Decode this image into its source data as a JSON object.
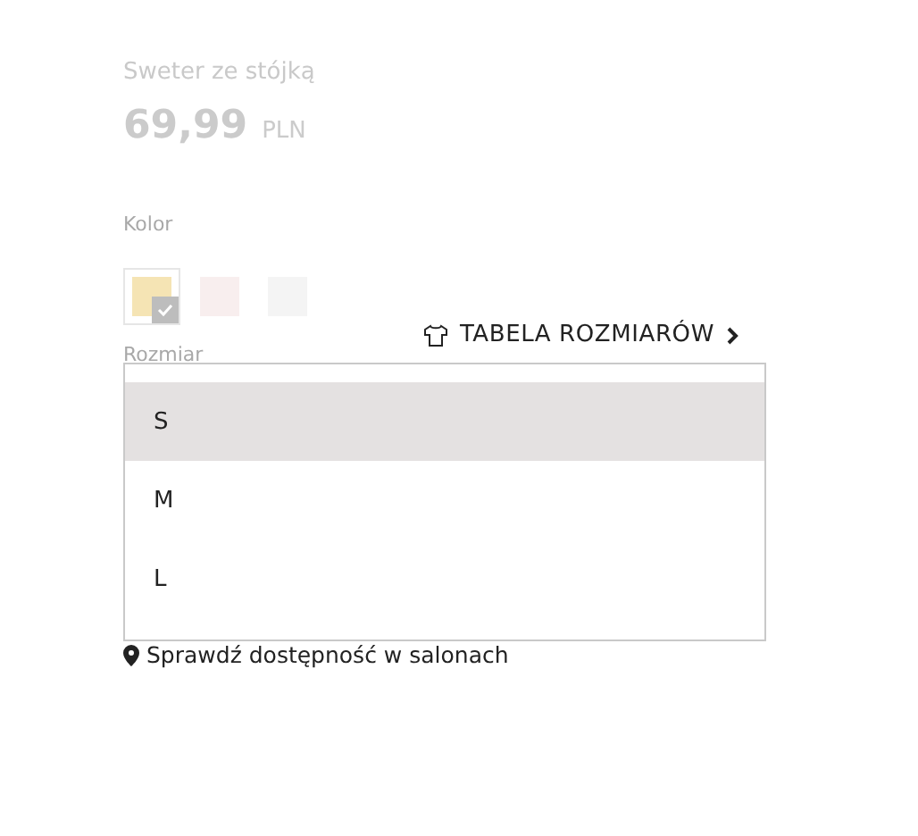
{
  "product": {
    "title": "Sweter ze stójką",
    "price": "69,99",
    "currency": "PLN"
  },
  "color_label": "Kolor",
  "swatches": [
    {
      "color": "#f5e4b4",
      "selected": true
    },
    {
      "color": "#f8eeee",
      "selected": false
    },
    {
      "color": "#f4f4f4",
      "selected": false
    }
  ],
  "size_chart_link": "TABELA ROZMIARÓW",
  "size_label": "Rozmiar",
  "size_options": [
    {
      "label": "S",
      "selected": true
    },
    {
      "label": "M",
      "selected": false
    },
    {
      "label": "L",
      "selected": false
    }
  ],
  "store_link": "Sprawdź dostępność w salonach"
}
